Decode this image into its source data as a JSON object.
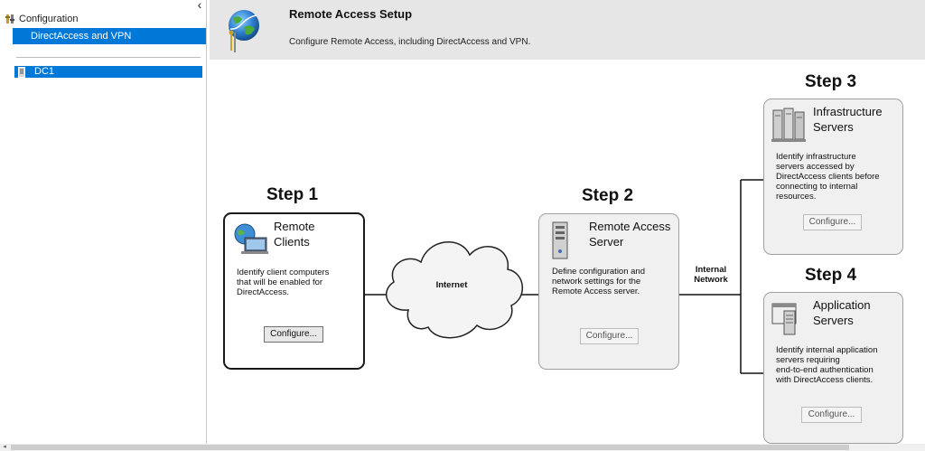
{
  "nav": {
    "collapse_glyph": "‹",
    "root_label": "Configuration",
    "root_icon": "configuration-icon",
    "items": [
      {
        "label": "DirectAccess and VPN",
        "selected": true
      }
    ],
    "servers": [
      {
        "label": "DC1",
        "icon": "server-icon",
        "selected": true
      }
    ]
  },
  "header": {
    "title": "Remote Access Setup",
    "subtitle": "Configure Remote Access, including DirectAccess and VPN.",
    "icon": "globe-network-icon"
  },
  "steps": {
    "step1": {
      "label": "Step 1",
      "title_line1": "Remote",
      "title_line2": "Clients",
      "description": [
        "Identify client computers",
        "that will be enabled for",
        "DirectAccess."
      ],
      "button": "Configure...",
      "enabled": true,
      "icon": "remote-clients-icon"
    },
    "step2": {
      "label": "Step 2",
      "title_line1": "Remote Access",
      "title_line2": "Server",
      "description": [
        "Define configuration and",
        "network settings for the",
        "Remote Access server."
      ],
      "button": "Configure...",
      "enabled": false,
      "icon": "server-tower-icon"
    },
    "step3": {
      "label": "Step 3",
      "title_line1": "Infrastructure",
      "title_line2": "Servers",
      "description": [
        "Identify infrastructure",
        "servers accessed by",
        "DirectAccess clients before",
        "connecting to internal",
        "resources."
      ],
      "button": "Configure...",
      "enabled": false,
      "icon": "server-rack-icon"
    },
    "step4": {
      "label": "Step 4",
      "title_line1": "Application",
      "title_line2": "Servers",
      "description": [
        "Identify internal application",
        "servers requiring",
        "end-to-end authentication",
        "with DirectAccess clients."
      ],
      "button": "Configure...",
      "enabled": false,
      "icon": "application-server-icon"
    }
  },
  "network": {
    "internet_label": "Internet",
    "internal_line1": "Internal",
    "internal_line2": "Network",
    "cloud_icon": "internet-cloud-icon"
  },
  "scrollbar": {
    "arrow_glyph": "◂"
  }
}
